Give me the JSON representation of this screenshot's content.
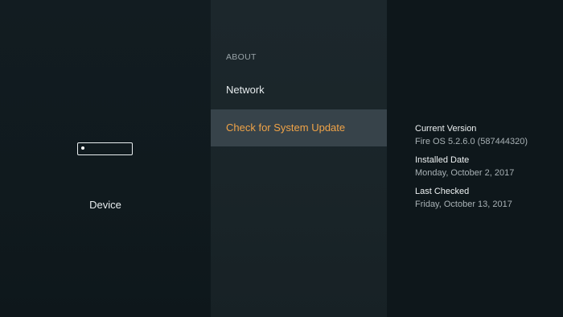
{
  "device_panel": {
    "icon": "fire-tv-stick-icon",
    "label": "Device"
  },
  "menu": {
    "section_header": "ABOUT",
    "items": [
      {
        "label": "Network",
        "selected": false
      },
      {
        "label": "Check for System Update",
        "selected": true
      }
    ]
  },
  "details": [
    {
      "label": "Current Version",
      "value": "Fire OS 5.2.6.0 (587444320)"
    },
    {
      "label": "Installed Date",
      "value": "Monday, October 2, 2017"
    },
    {
      "label": "Last Checked",
      "value": "Friday, October 13, 2017"
    }
  ],
  "colors": {
    "background": "#0f171b",
    "menu_panel": "#1c272c",
    "selected_row": "#37434a",
    "accent": "#f0a347"
  }
}
